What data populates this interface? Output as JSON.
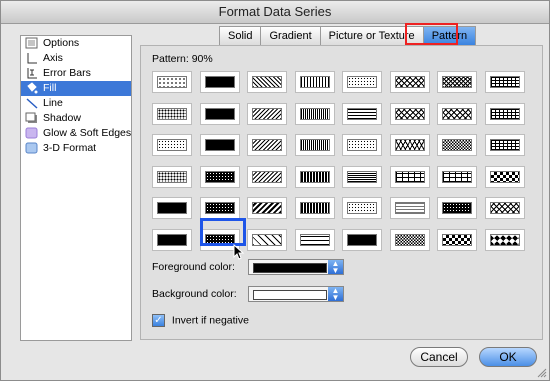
{
  "window": {
    "title": "Format Data Series"
  },
  "sidebar": {
    "items": [
      {
        "label": "Options",
        "icon": "options-icon"
      },
      {
        "label": "Axis",
        "icon": "axis-icon"
      },
      {
        "label": "Error Bars",
        "icon": "error-bars-icon"
      },
      {
        "label": "Fill",
        "icon": "fill-bucket-icon",
        "selected": true
      },
      {
        "label": "Line",
        "icon": "line-icon"
      },
      {
        "label": "Shadow",
        "icon": "shadow-icon"
      },
      {
        "label": "Glow & Soft Edges",
        "icon": "glow-icon"
      },
      {
        "label": "3-D Format",
        "icon": "3d-format-icon"
      }
    ]
  },
  "tabs": [
    "Solid",
    "Gradient",
    "Picture or Texture",
    "Pattern"
  ],
  "active_tab": "Pattern",
  "pattern": {
    "label": "Pattern:",
    "value": "90%"
  },
  "foreground": {
    "label": "Foreground color:",
    "color": "#000000"
  },
  "background": {
    "label": "Background color:",
    "color": "#ffffff"
  },
  "invert": {
    "label": "Invert if negative",
    "checked": true
  },
  "buttons": {
    "cancel": "Cancel",
    "ok": "OK"
  },
  "colors": {
    "accent": "#3c78d8",
    "highlight_red": "#e22222",
    "selection_blue": "#1e55e8"
  }
}
